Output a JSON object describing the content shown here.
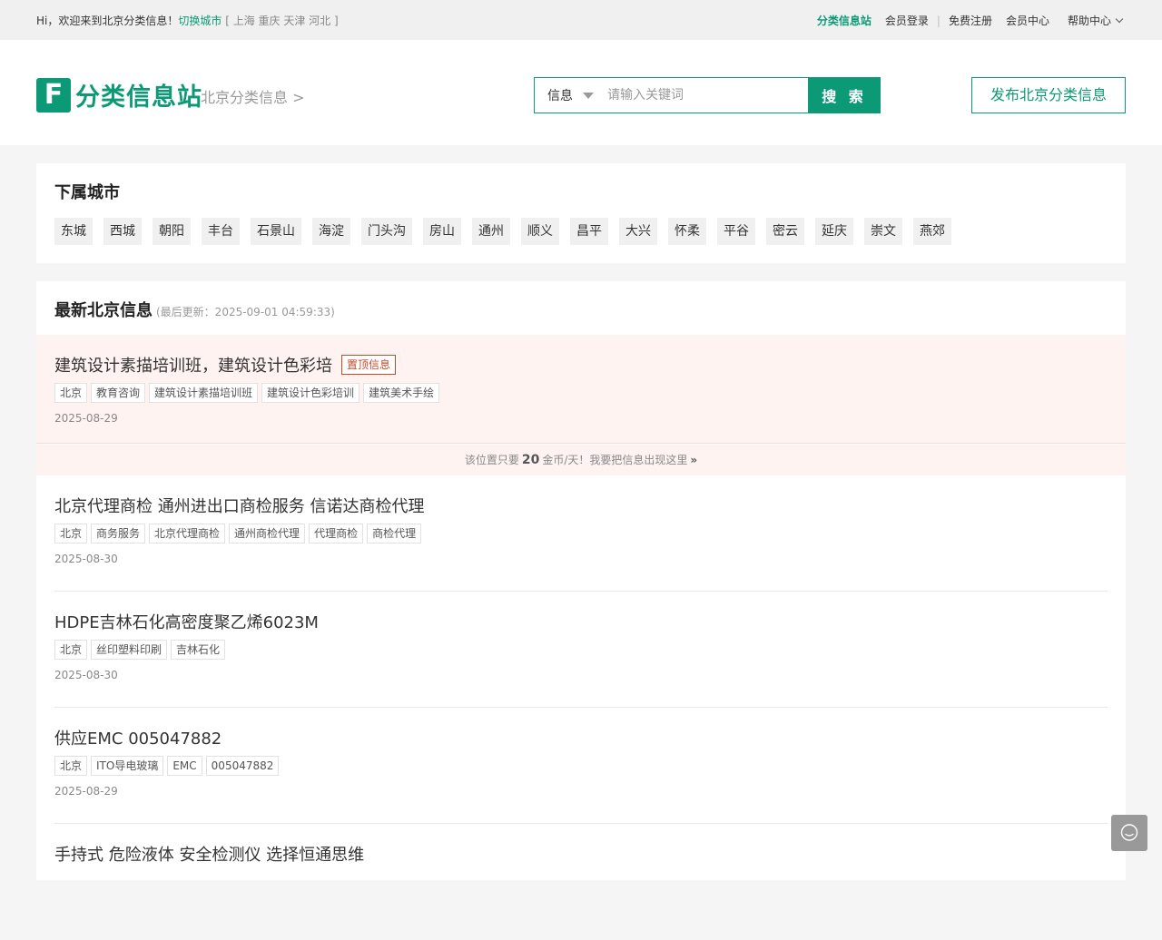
{
  "topbar": {
    "welcome": "Hi，欢迎来到北京分类信息！",
    "switch_city": "切换城市",
    "city_links": "[ 上海 重庆 天津 河北 ]",
    "site_link": "分类信息站",
    "login": "会员登录",
    "separator": "|",
    "register": "免费注册",
    "member_center": "会员中心",
    "help": "帮助中心"
  },
  "header": {
    "logo_letter": "F",
    "logo_text": "分类信息站",
    "breadcrumb": "北京分类信息 >",
    "search_category": "信息",
    "search_placeholder": "请输入关键词",
    "search_button": "搜 索",
    "publish_button": "发布北京分类信息"
  },
  "cities": {
    "title": "下属城市",
    "items": [
      "东城",
      "西城",
      "朝阳",
      "丰台",
      "石景山",
      "海淀",
      "门头沟",
      "房山",
      "通州",
      "顺义",
      "昌平",
      "大兴",
      "怀柔",
      "平谷",
      "密云",
      "延庆",
      "崇文",
      "燕郊"
    ]
  },
  "listing": {
    "title": "最新北京信息",
    "updated": "(最后更新：2025-09-01 04:59:33)",
    "top_item": {
      "title": "建筑设计素描培训班，建筑设计色彩培",
      "badge": "置顶信息",
      "tags": [
        "北京",
        "教育咨询",
        "建筑设计素描培训班",
        "建筑设计色彩培训",
        "建筑美术手绘"
      ],
      "date": "2025-08-29"
    },
    "promo": {
      "prefix": "该位置只要",
      "amount": "20",
      "suffix": "金币/天！我要把信息出现这里",
      "arrow": "»"
    },
    "items": [
      {
        "title": "北京代理商检 通州进出口商检服务 信诺达商检代理",
        "tags": [
          "北京",
          "商务服务",
          "北京代理商检",
          "通州商检代理",
          "代理商检",
          "商检代理"
        ],
        "date": "2025-08-30"
      },
      {
        "title": "HDPE吉林石化高密度聚乙烯6023M",
        "tags": [
          "北京",
          "丝印塑料印刷",
          "吉林石化"
        ],
        "date": "2025-08-30"
      },
      {
        "title": "供应EMC 005047882",
        "tags": [
          "北京",
          "ITO导电玻璃",
          "EMC",
          "005047882"
        ],
        "date": "2025-08-29"
      },
      {
        "title": "手持式 危险液体 安全检测仪 选择恒通思维",
        "tags": [],
        "date": ""
      }
    ]
  },
  "colors": {
    "brand": "#0c9a76",
    "top_bg": "#fff3f1",
    "badge": "#c24b2a"
  },
  "icons": {
    "float_button": "chat-bubble-icon",
    "help_dropdown": "chevron-down-icon",
    "search_dropdown": "caret-down-icon"
  }
}
